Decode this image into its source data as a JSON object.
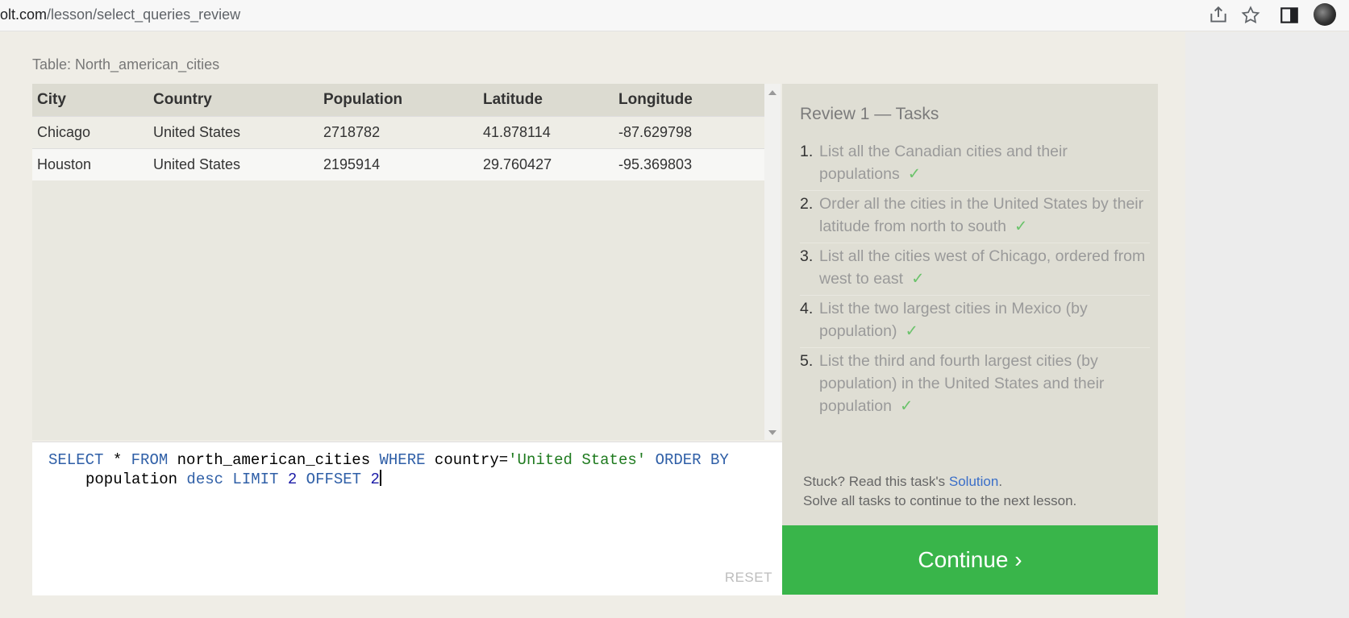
{
  "browser": {
    "url_host": "olt.com",
    "url_path": "/lesson/select_queries_review"
  },
  "lesson": {
    "table_label": "Table: North_american_cities"
  },
  "results": {
    "columns": [
      "City",
      "Country",
      "Population",
      "Latitude",
      "Longitude"
    ],
    "rows": [
      [
        "Chicago",
        "United States",
        "2718782",
        "41.878114",
        "-87.629798"
      ],
      [
        "Houston",
        "United States",
        "2195914",
        "29.760427",
        "-95.369803"
      ]
    ]
  },
  "editor": {
    "line1": {
      "t1": "SELECT",
      "t2": " * ",
      "t3": "FROM",
      "t4": " north_american_cities ",
      "t5": "WHERE",
      "t6": " country=",
      "t7": "'United States'",
      "t8": " ORDER BY"
    },
    "line2": {
      "t1": "population ",
      "t2": "desc",
      "t3": " LIMIT ",
      "t4": "2",
      "t5": " OFFSET ",
      "t6": "2"
    },
    "reset_label": "RESET"
  },
  "tasks": {
    "title": "Review 1 — Tasks",
    "check": "✓",
    "items": [
      {
        "num": "1.",
        "text": "List all the Canadian cities and their populations"
      },
      {
        "num": "2.",
        "text": "Order all the cities in the United States by their latitude from north to south"
      },
      {
        "num": "3.",
        "text": "List all the cities west of Chicago, ordered from west to east"
      },
      {
        "num": "4.",
        "text": "List the two largest cities in Mexico (by population)"
      },
      {
        "num": "5.",
        "text": "List the third and fourth largest cities (by population) in the United States and their population"
      }
    ],
    "help_prefix": "Stuck? Read this task's ",
    "help_link": "Solution",
    "help_suffix": ".",
    "help_line2": "Solve all tasks to continue to the next lesson."
  },
  "continue_label": "Continue ›"
}
